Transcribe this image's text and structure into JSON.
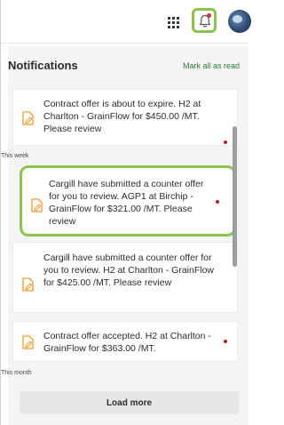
{
  "header": {
    "apps_icon": "grid-apps-icon",
    "bell_icon": "bell-icon",
    "avatar": "user-avatar"
  },
  "panel": {
    "title": "Notifications",
    "mark_all": "Mark all as read"
  },
  "notifications": [
    {
      "text": "Contract offer is about to expire. H2 at Charlton - GrainFlow for $450.00 /MT. Please review"
    },
    {
      "text": "Cargill have submitted a counter offer for you to review. AGP1 at Birchip - GrainFlow for $321.00 /MT. Please review"
    },
    {
      "text": "Cargill have submitted a counter offer for you to review. H2 at Charlton - GrainFlow for $425.00 /MT. Please review"
    },
    {
      "text": "Contract offer accepted. H2 at Charlton - GrainFlow for $363.00 /MT."
    }
  ],
  "sections": {
    "this_week": "This week",
    "this_month": "This month"
  },
  "load_more": "Load more",
  "colors": {
    "accent_green": "#8bc34a",
    "link_green": "#2e7d32",
    "unread_dot": "#b71c1c",
    "doc_icon": "#f29a2e"
  }
}
